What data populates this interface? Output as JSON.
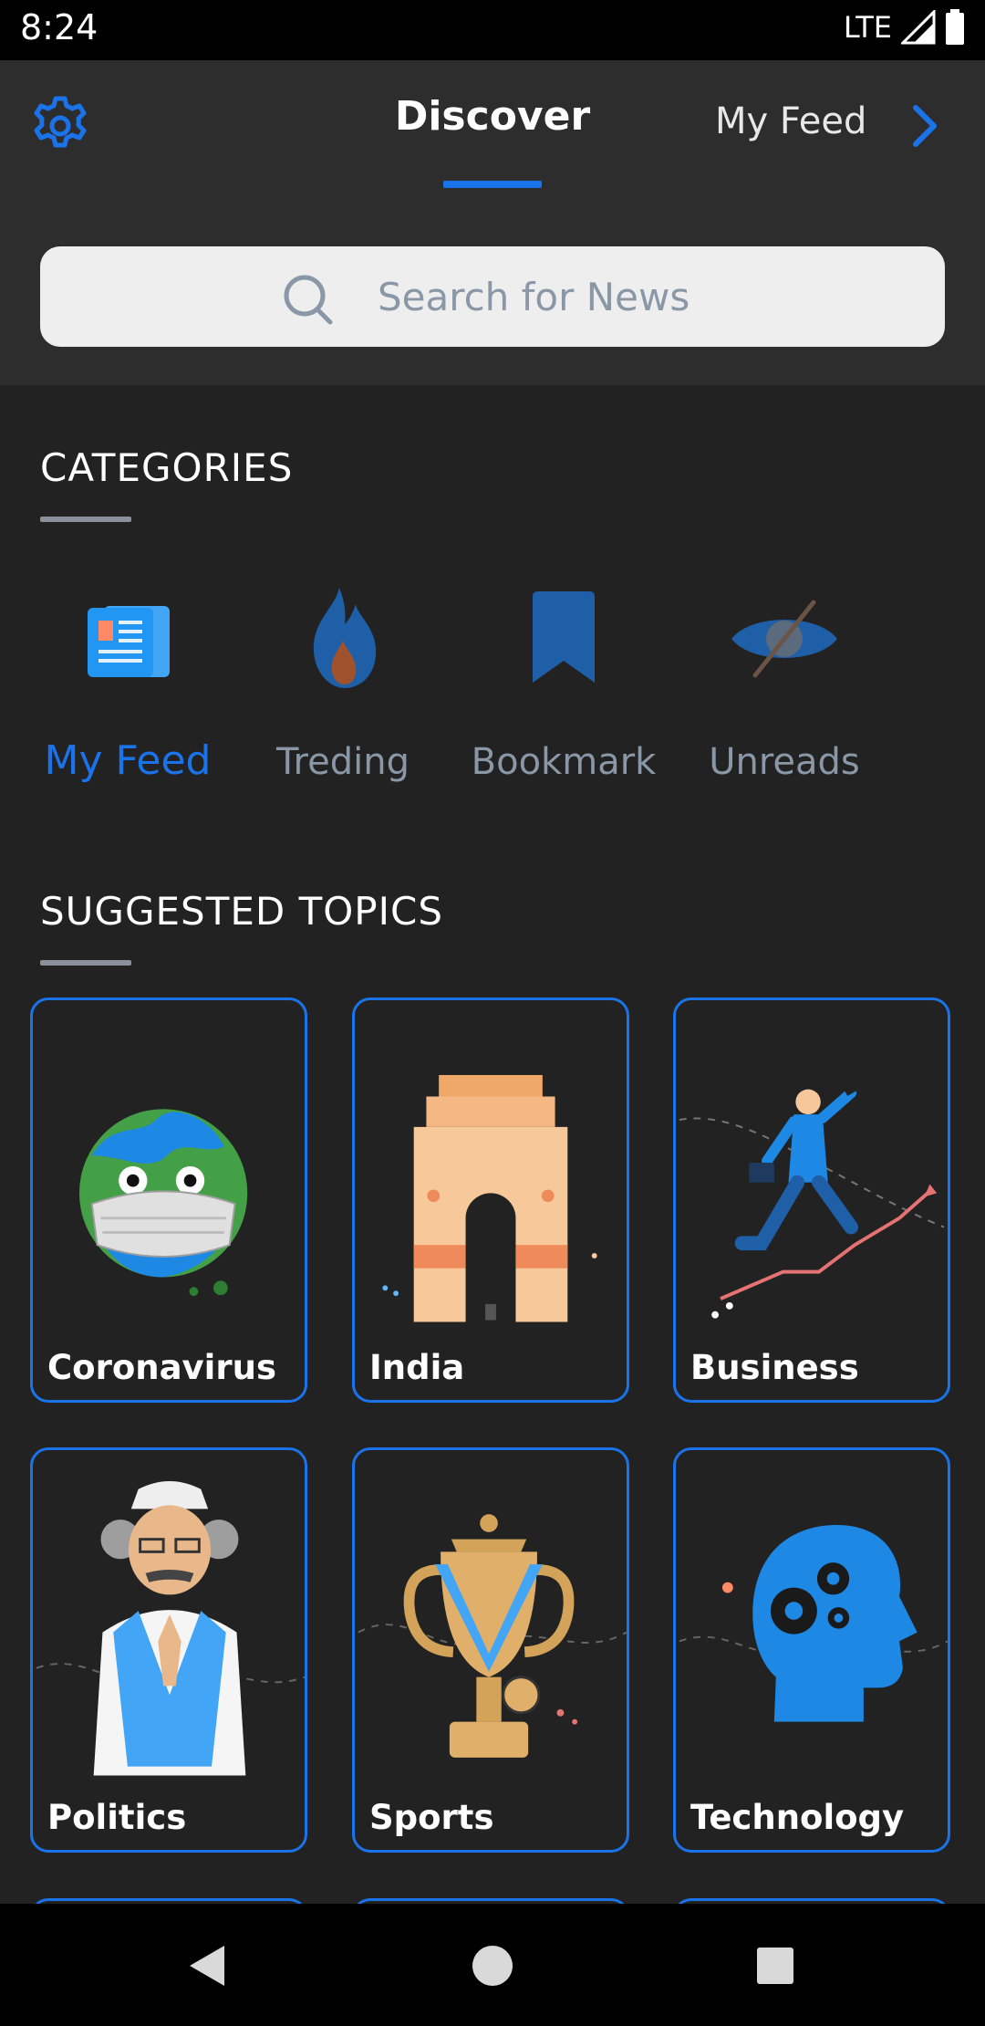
{
  "status_bar": {
    "time": "8:24",
    "network": "LTE"
  },
  "header": {
    "settings_icon": "gear-icon",
    "active_tab": "Discover",
    "next_tab": "My Feed",
    "next_icon": "chevron-right-icon",
    "accent": "#1a73e8"
  },
  "search": {
    "placeholder": "Search for News",
    "icon": "search-icon"
  },
  "categories": {
    "title": "CATEGORIES",
    "items": [
      {
        "label": "My Feed",
        "icon": "newspaper-icon",
        "active": true
      },
      {
        "label": "Treding",
        "icon": "flame-icon",
        "active": false
      },
      {
        "label": "Bookmark",
        "icon": "bookmark-icon",
        "active": false
      },
      {
        "label": "Unreads",
        "icon": "eye-slash-icon",
        "active": false
      }
    ]
  },
  "suggested_topics": {
    "title": "SUGGESTED TOPICS",
    "items": [
      {
        "label": "Coronavirus",
        "icon": "masked-earth-illustration"
      },
      {
        "label": "India",
        "icon": "india-gate-illustration"
      },
      {
        "label": "Business",
        "icon": "businessman-growth-illustration"
      },
      {
        "label": "Politics",
        "icon": "politician-namaste-illustration"
      },
      {
        "label": "Sports",
        "icon": "trophy-medal-illustration"
      },
      {
        "label": "Technology",
        "icon": "gear-head-illustration"
      }
    ]
  },
  "nav_bar": {
    "back_icon": "back-triangle-icon",
    "home_icon": "home-circle-icon",
    "recents_icon": "recents-square-icon"
  }
}
